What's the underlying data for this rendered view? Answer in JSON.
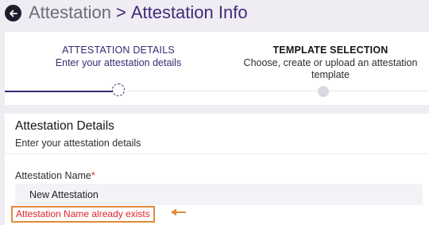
{
  "header": {
    "breadcrumb_root": "Attestation",
    "breadcrumb_separator": ">",
    "breadcrumb_current": "Attestation Info",
    "back_icon": "arrow-left-circle-icon"
  },
  "stepper": {
    "steps": [
      {
        "title": "ATTESTATION DETAILS",
        "subtitle": "Enter your attestation details",
        "state": "current"
      },
      {
        "title": "TEMPLATE SELECTION",
        "subtitle": "Choose, create or upload an attestation template",
        "state": "upcoming"
      }
    ]
  },
  "details": {
    "title": "Attestation Details",
    "subtitle": "Enter your attestation details",
    "name_field": {
      "label": "Attestation Name",
      "required_mark": "*",
      "value": "New Attestation",
      "error": "Attestation Name already exists"
    }
  },
  "colors": {
    "accent": "#3a2a74",
    "error": "#e0242b",
    "highlight": "#e08a3c",
    "background": "#efedf3"
  }
}
